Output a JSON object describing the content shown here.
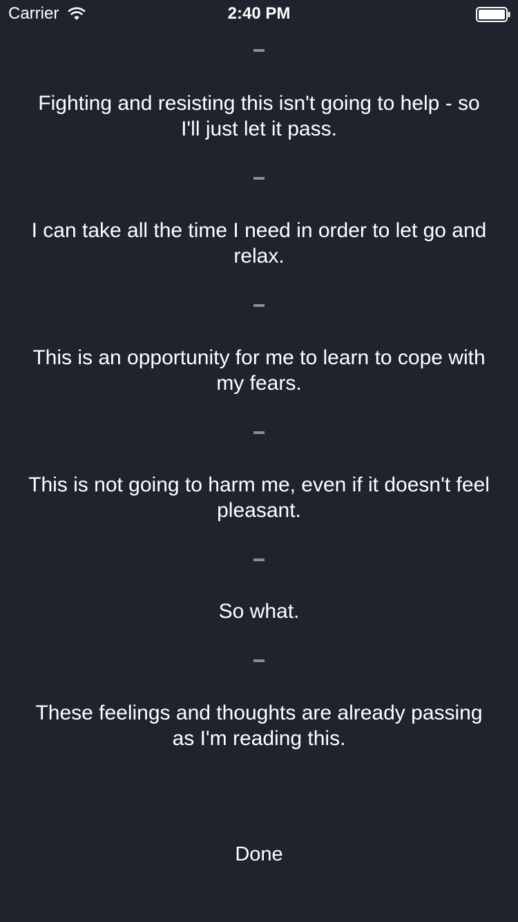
{
  "status_bar": {
    "carrier": "Carrier",
    "time": "2:40 PM",
    "wifi_icon": "wifi-icon",
    "battery_icon": "battery-full-icon"
  },
  "affirmations": [
    "Fighting and resisting this isn't going to help - so I'll just let it pass.",
    "I can take all the time I need in order to let go and relax.",
    "This is an opportunity for me to learn to cope with my fears.",
    "This is not going to harm me, even if it doesn't feel pleasant.",
    "So what.",
    "These feelings and thoughts are already passing as I'm reading this."
  ],
  "done_label": "Done",
  "colors": {
    "background": "#1e232e",
    "text": "#ffffff",
    "separator": "#8a8d93"
  }
}
